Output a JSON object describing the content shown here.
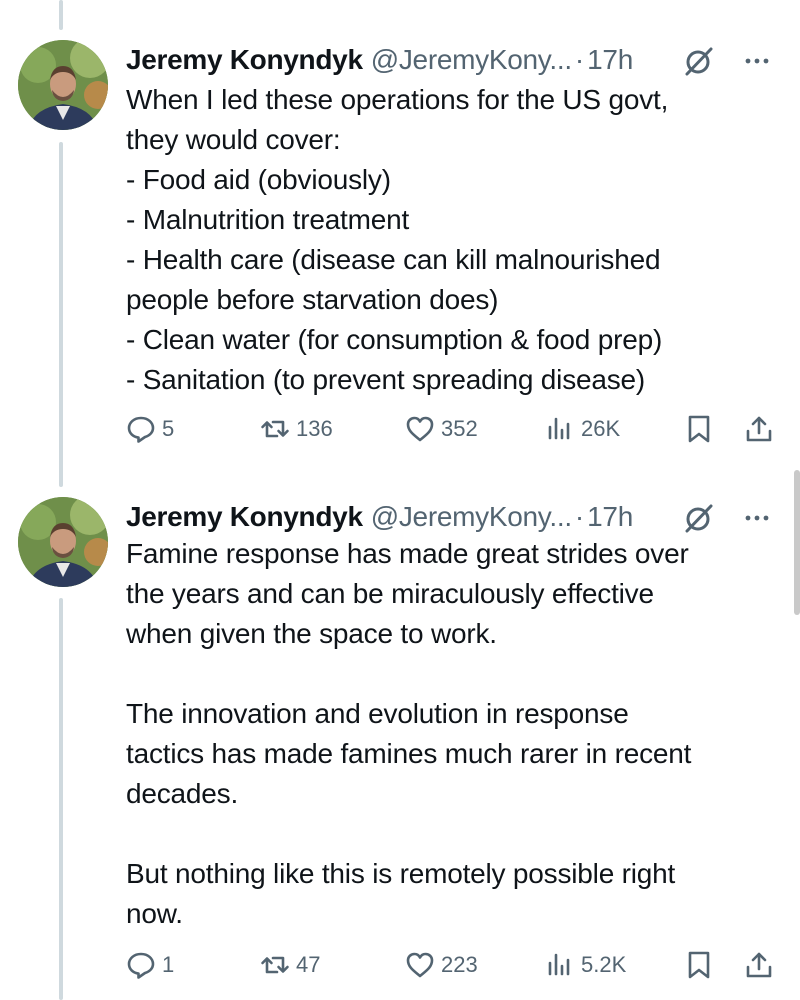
{
  "tweets": [
    {
      "name": "Jeremy Konyndyk",
      "handle": "@JeremyKony...",
      "dot": "·",
      "time": "17h",
      "text": "When I led these operations for the US govt,\nthey would cover:\n- Food aid (obviously)\n- Malnutrition treatment\n- Health care (disease can kill malnourished\npeople before starvation does)\n- Clean water (for consumption & food prep)\n- Sanitation (to prevent spreading disease)",
      "replies": "5",
      "reposts": "136",
      "likes": "352",
      "views": "26K"
    },
    {
      "name": "Jeremy Konyndyk",
      "handle": "@JeremyKony...",
      "dot": "·",
      "time": "17h",
      "text": "Famine response has made great strides over\nthe years and can be miraculously effective\nwhen given the space to work.\n\nThe innovation and evolution in response\ntactics has made famines much rarer in recent\ndecades.\n\nBut nothing like this is remotely possible right\nnow.",
      "replies": "1",
      "reposts": "47",
      "likes": "223",
      "views": "5.2K"
    }
  ],
  "icons": {
    "reply": "reply-icon",
    "repost": "repost-icon",
    "like": "like-icon",
    "views": "views-icon",
    "bookmark": "bookmark-icon",
    "share": "share-icon",
    "grok": "grok-icon",
    "more": "more-icon"
  },
  "colors": {
    "text": "#0f1419",
    "secondary": "#536471",
    "thread_line": "#cfd9de"
  }
}
